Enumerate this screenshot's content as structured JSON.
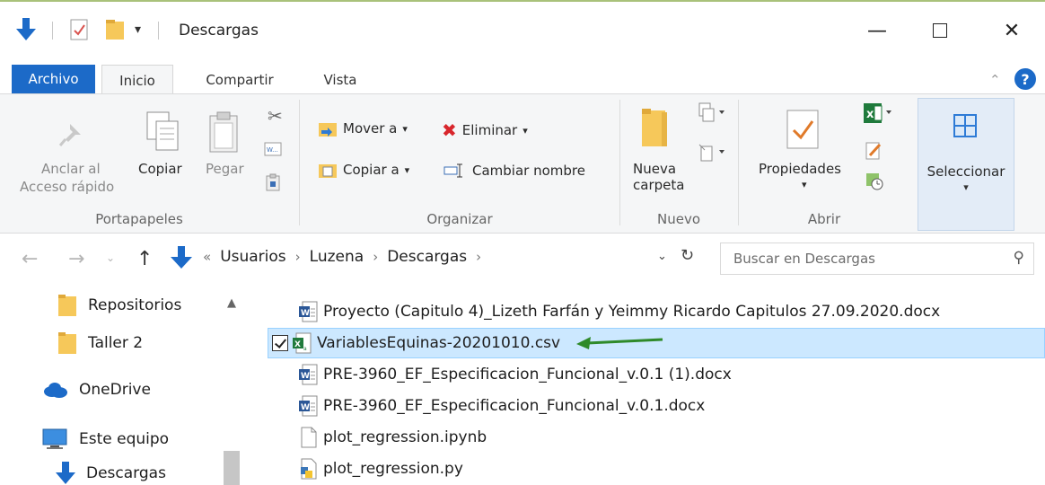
{
  "window": {
    "title": "Descargas",
    "qa_dropdown": "▾",
    "minimize": "—",
    "maximize": "☐",
    "close": "✕"
  },
  "tabs": {
    "file": "Archivo",
    "items": [
      "Inicio",
      "Compartir",
      "Vista"
    ],
    "active": "Inicio",
    "collapse_icon": "chevron-up-icon",
    "help_icon": "help-icon"
  },
  "ribbon": {
    "portapapeles": {
      "label": "Portapapeles",
      "pin_line1": "Anclar al",
      "pin_line2": "Acceso rápido",
      "copy": "Copiar",
      "paste": "Pegar"
    },
    "organizar": {
      "label": "Organizar",
      "move": "Mover a",
      "copy_to": "Copiar a",
      "delete": "Eliminar",
      "rename": "Cambiar nombre",
      "dropdown": "▾"
    },
    "nuevo": {
      "label": "Nuevo",
      "new_folder_line1": "Nueva",
      "new_folder_line2": "carpeta"
    },
    "abrir": {
      "label": "Abrir",
      "properties": "Propiedades"
    },
    "seleccionar": {
      "label": "Seleccionar"
    }
  },
  "address": {
    "overflow": "«",
    "crumbs": [
      "Usuarios",
      "Luzena",
      "Descargas"
    ],
    "separator": "›",
    "search_placeholder": "Buscar en Descargas"
  },
  "nav_pane": {
    "items": [
      {
        "label": "Repositorios",
        "icon": "folder-icon"
      },
      {
        "label": "Taller 2",
        "icon": "folder-icon"
      },
      {
        "label": "OneDrive",
        "icon": "cloud-icon"
      },
      {
        "label": "Este equipo",
        "icon": "computer-icon"
      },
      {
        "label": "Descargas",
        "icon": "download-arrow-icon"
      }
    ]
  },
  "files": [
    {
      "name": "Proyecto (Capitulo 4)_Lizeth Farfán y Yeimmy Ricardo Capitulos  27.09.2020.docx",
      "icon": "word-doc-icon"
    },
    {
      "name": "VariablesEquinas-20201010.csv",
      "icon": "excel-csv-icon",
      "selected": true
    },
    {
      "name": "PRE-3960_EF_Especificacion_Funcional_v.0.1 (1).docx",
      "icon": "word-doc-icon"
    },
    {
      "name": "PRE-3960_EF_Especificacion_Funcional_v.0.1.docx",
      "icon": "word-doc-icon"
    },
    {
      "name": "plot_regression.ipynb",
      "icon": "blank-file-icon"
    },
    {
      "name": "plot_regression.py",
      "icon": "python-file-icon"
    }
  ],
  "colors": {
    "accent": "#1c6ac8",
    "selection": "#cce8ff",
    "annotation_arrow": "#2f8a2a",
    "folder": "#f6c85a"
  }
}
